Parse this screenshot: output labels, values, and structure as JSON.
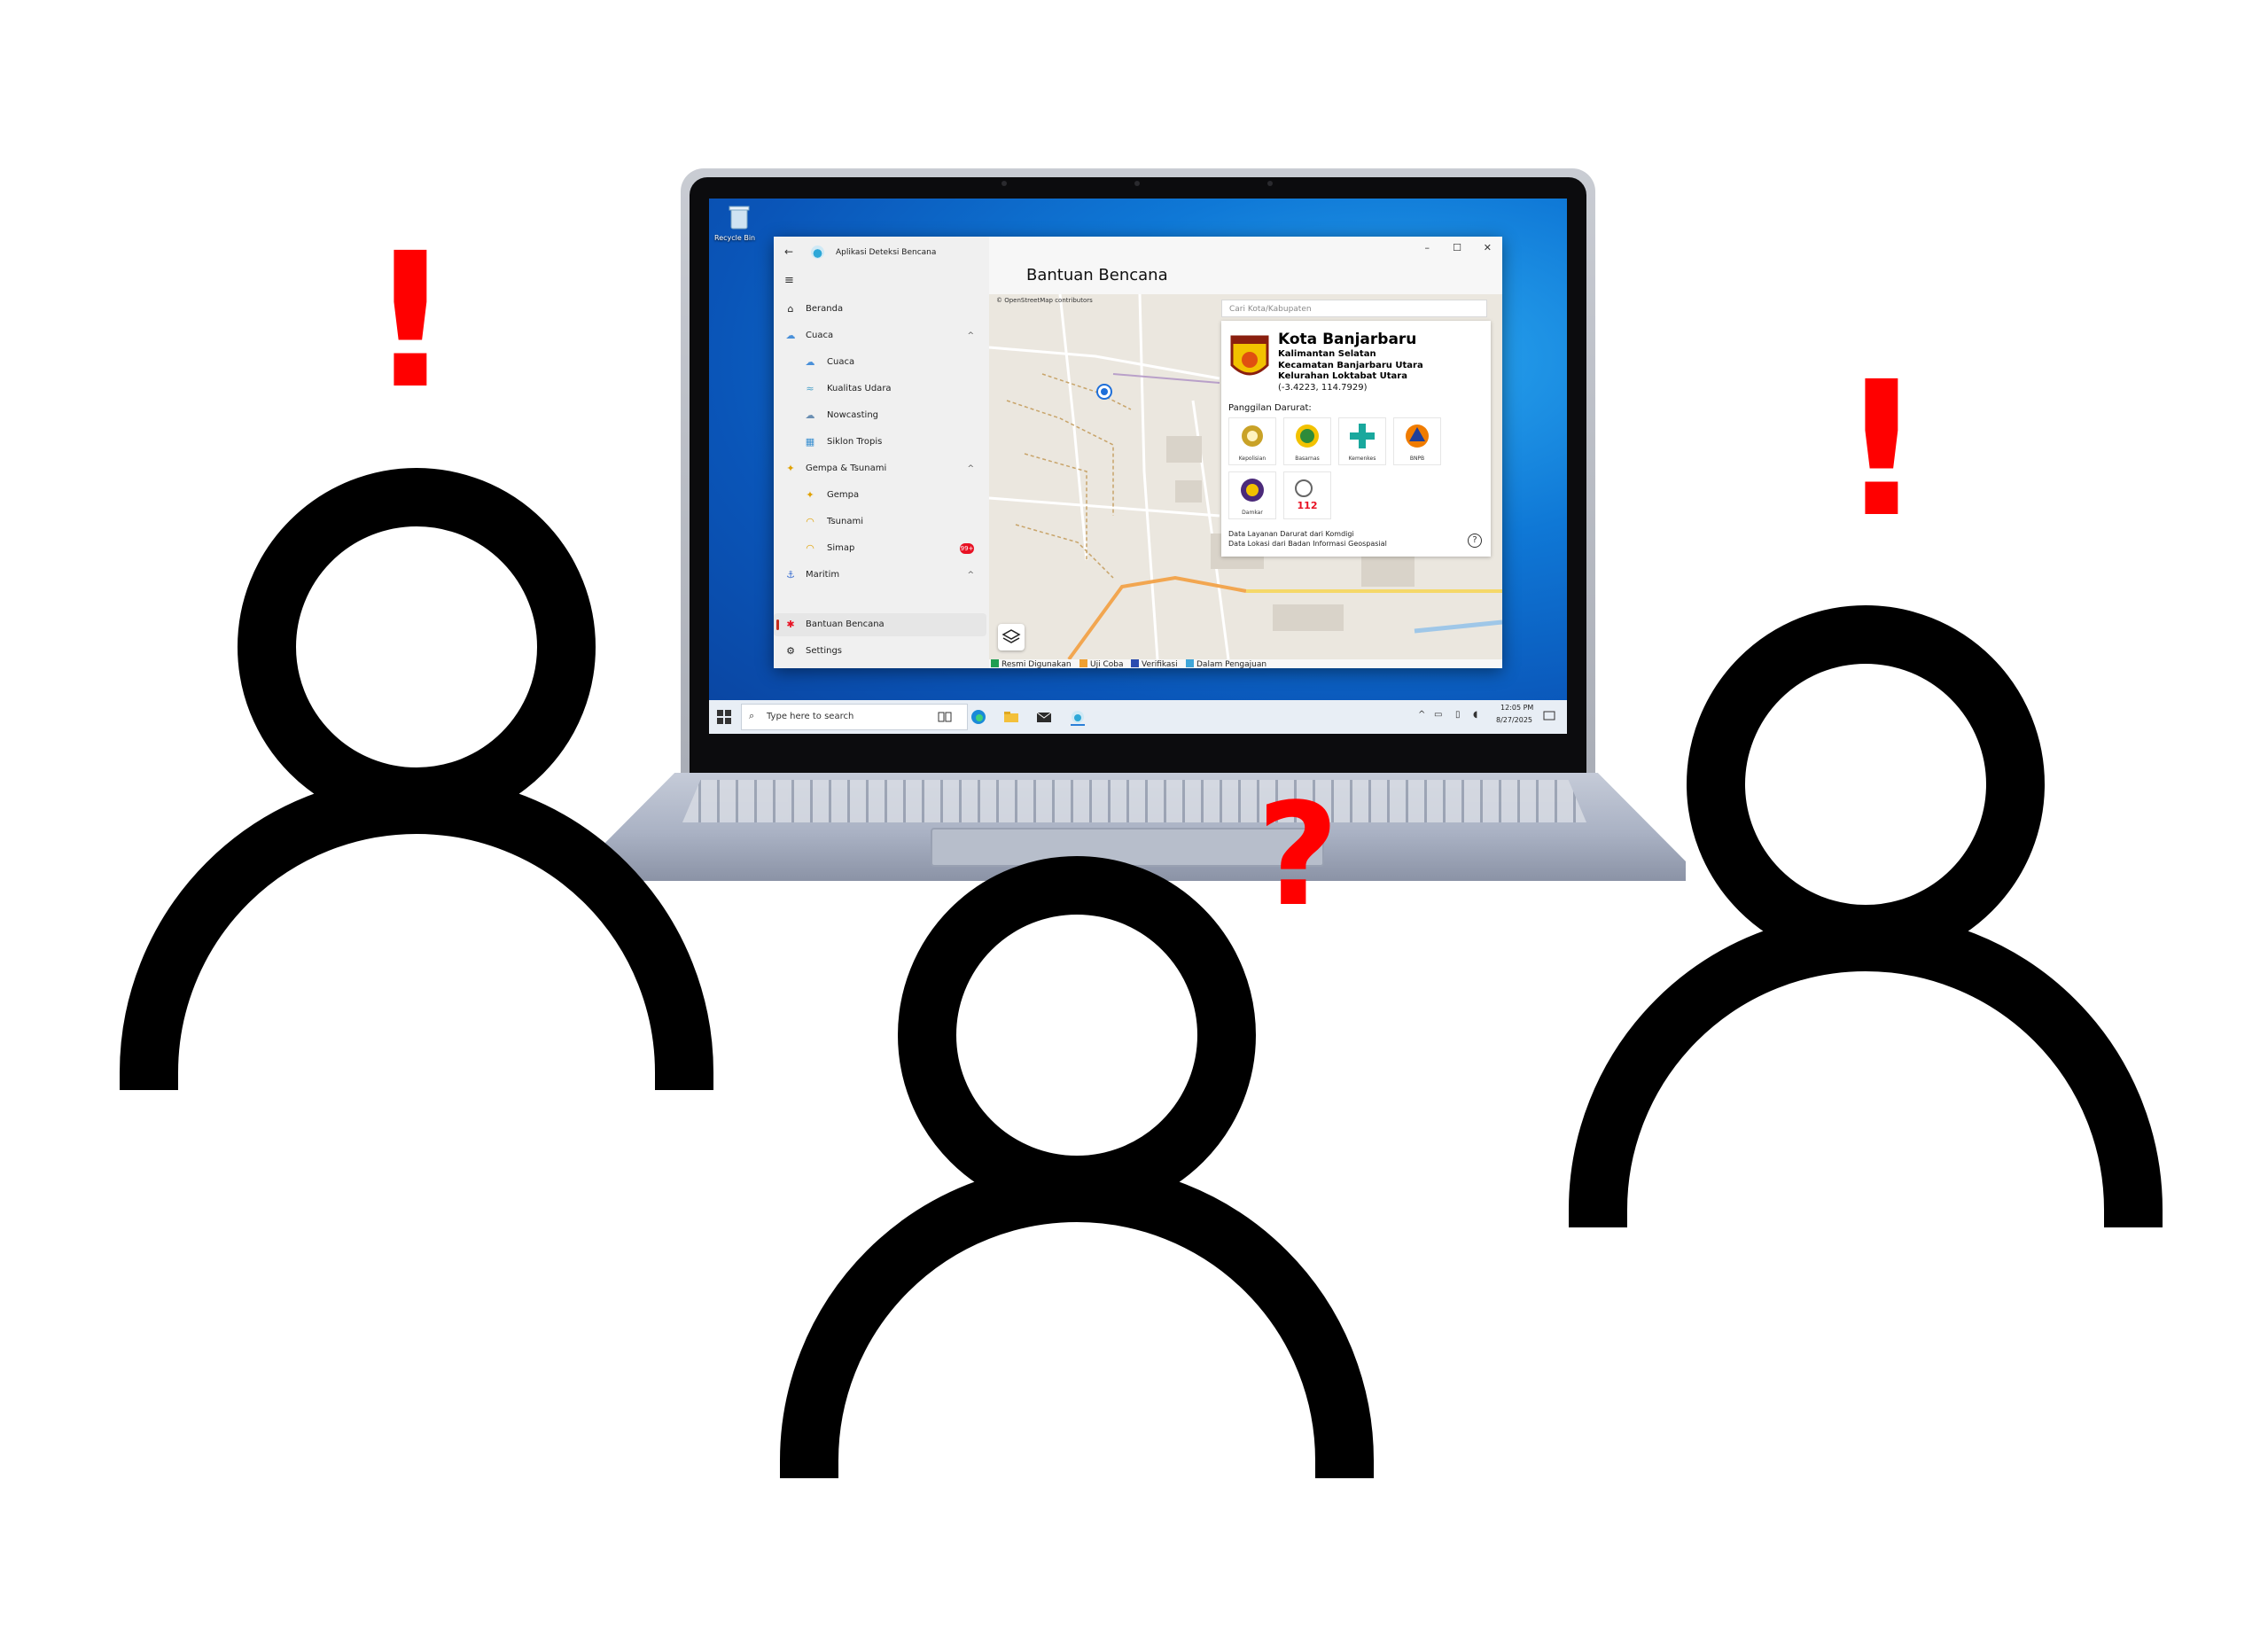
{
  "app": {
    "title": "Aplikasi Deteksi Bencana",
    "page_title": "Bantuan Bencana",
    "nav": {
      "back": "←",
      "items": [
        {
          "label": "Beranda",
          "icon": "home-icon"
        },
        {
          "label": "Cuaca",
          "icon": "cloud-icon",
          "chevron": "^"
        },
        {
          "label": "Cuaca",
          "icon": "cloud-icon",
          "sub": true
        },
        {
          "label": "Kualitas Udara",
          "icon": "wind-icon",
          "sub": true
        },
        {
          "label": "Nowcasting",
          "icon": "cloud-icon",
          "sub": true
        },
        {
          "label": "Siklon Tropis",
          "icon": "cyclone-icon",
          "sub": true
        },
        {
          "label": "Gempa & Tsunami",
          "icon": "earthquake-icon",
          "chevron": "^"
        },
        {
          "label": "Gempa",
          "icon": "earthquake-icon",
          "sub": true
        },
        {
          "label": "Tsunami",
          "icon": "tsunami-icon",
          "sub": true
        },
        {
          "label": "Simap",
          "icon": "simap-icon",
          "sub": true,
          "badge": "99+"
        },
        {
          "label": "Maritim",
          "icon": "anchor-icon",
          "chevron": "^"
        },
        {
          "label": "Bantuan Bencana",
          "icon": "asterisk-icon",
          "active": true
        },
        {
          "label": "Settings",
          "icon": "gear-icon"
        }
      ]
    },
    "map": {
      "attribution": "© OpenStreetMap contributors",
      "search_placeholder": "Cari Kota/Kabupaten"
    },
    "info": {
      "city": "Kota Banjarbaru",
      "province": "Kalimantan Selatan",
      "district": "Kecamatan Banjarbaru Utara",
      "village": "Kelurahan Loktabat Utara",
      "coords": "(-3.4223, 114.7929)",
      "emergency_label": "Panggilan Darurat:",
      "services": [
        {
          "label": "Kepolisian",
          "color": "#c9a227"
        },
        {
          "label": "Basarnas",
          "color": "#f2c200"
        },
        {
          "label": "Kemenkes",
          "color": "#19a89d"
        },
        {
          "label": "BNPB",
          "color": "#f07c00"
        },
        {
          "label": "Damkar",
          "color": "#4b2a7a"
        },
        {
          "label": "112",
          "color": "#e81123"
        }
      ],
      "note_1": "Data Layanan Darurat dari Komdigi",
      "note_2": "Data Lokasi dari Badan Informasi Geospasial"
    },
    "legend": [
      {
        "label": "Resmi Digunakan",
        "color": "#1e9e52"
      },
      {
        "label": "Uji Coba",
        "color": "#f0a030"
      },
      {
        "label": "Verifikasi",
        "color": "#2a4cb0"
      },
      {
        "label": "Dalam Pengajuan",
        "color": "#3fa6d9"
      }
    ]
  },
  "desktop": {
    "recycle_bin": "Recycle Bin"
  },
  "taskbar": {
    "search_placeholder": "Type here to search",
    "time": "12:05 PM",
    "date": "8/27/2025"
  },
  "marks": {
    "left": "!",
    "center": "?",
    "right": "!",
    "color": "#ff0000"
  }
}
